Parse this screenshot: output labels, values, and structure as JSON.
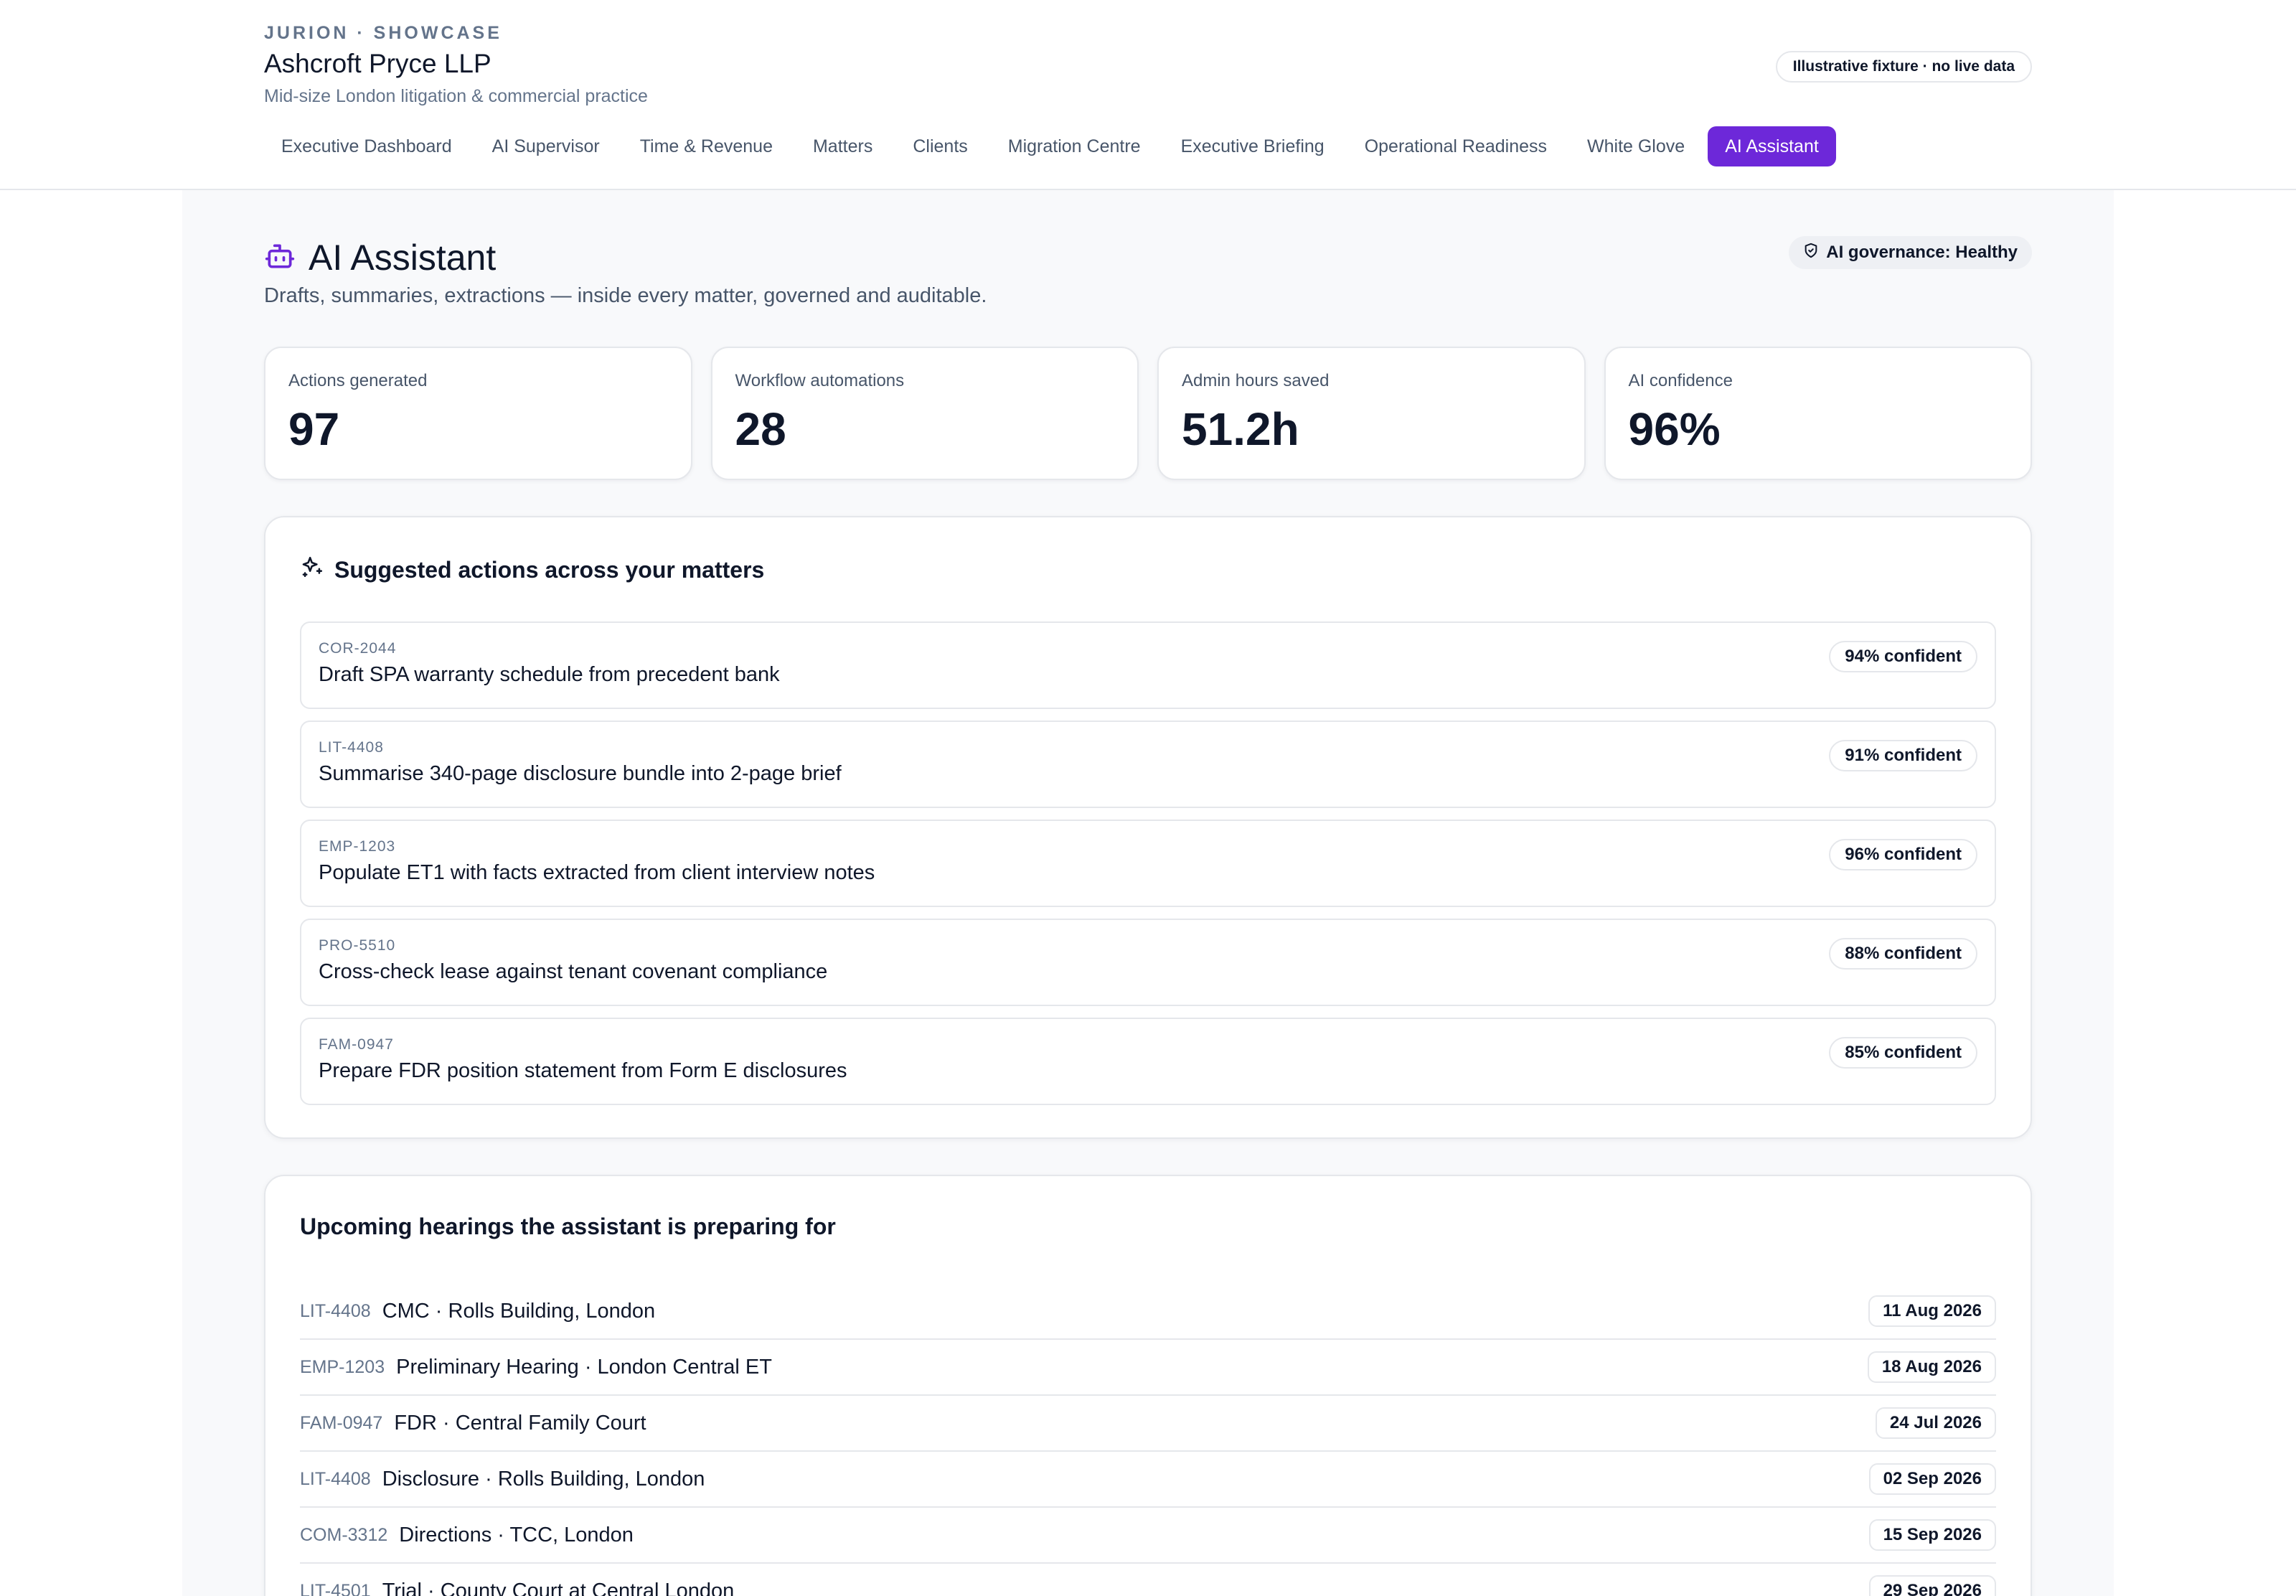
{
  "header": {
    "kicker": "JURION · SHOWCASE",
    "firm_name": "Ashcroft Pryce LLP",
    "firm_description": "Mid-size London litigation & commercial practice",
    "fixture_badge": "Illustrative fixture · no live data"
  },
  "nav": {
    "items": [
      {
        "label": "Executive Dashboard",
        "active": false
      },
      {
        "label": "AI Supervisor",
        "active": false
      },
      {
        "label": "Time & Revenue",
        "active": false
      },
      {
        "label": "Matters",
        "active": false
      },
      {
        "label": "Clients",
        "active": false
      },
      {
        "label": "Migration Centre",
        "active": false
      },
      {
        "label": "Executive Briefing",
        "active": false
      },
      {
        "label": "Operational Readiness",
        "active": false
      },
      {
        "label": "White Glove",
        "active": false
      },
      {
        "label": "AI Assistant",
        "active": true
      }
    ]
  },
  "page": {
    "title": "AI Assistant",
    "title_icon": "robot-icon",
    "subtitle": "Drafts, summaries, extractions — inside every matter, governed and auditable.",
    "governance_badge": "AI governance: Healthy",
    "governance_icon": "shield-check-icon"
  },
  "stats": [
    {
      "label": "Actions generated",
      "value": "97"
    },
    {
      "label": "Workflow automations",
      "value": "28"
    },
    {
      "label": "Admin hours saved",
      "value": "51.2h"
    },
    {
      "label": "AI confidence",
      "value": "96%"
    }
  ],
  "suggested_actions": {
    "title": "Suggested actions across your matters",
    "icon": "sparkles-icon",
    "items": [
      {
        "code": "COR-2044",
        "text": "Draft SPA warranty schedule from precedent bank",
        "confidence": "94% confident"
      },
      {
        "code": "LIT-4408",
        "text": "Summarise 340-page disclosure bundle into 2-page brief",
        "confidence": "91% confident"
      },
      {
        "code": "EMP-1203",
        "text": "Populate ET1 with facts extracted from client interview notes",
        "confidence": "96% confident"
      },
      {
        "code": "PRO-5510",
        "text": "Cross-check lease against tenant covenant compliance",
        "confidence": "88% confident"
      },
      {
        "code": "FAM-0947",
        "text": "Prepare FDR position statement from Form E disclosures",
        "confidence": "85% confident"
      }
    ]
  },
  "hearings": {
    "title": "Upcoming hearings the assistant is preparing for",
    "items": [
      {
        "code": "LIT-4408",
        "text": "CMC · Rolls Building, London",
        "date": "11 Aug 2026"
      },
      {
        "code": "EMP-1203",
        "text": "Preliminary Hearing · London Central ET",
        "date": "18 Aug 2026"
      },
      {
        "code": "FAM-0947",
        "text": "FDR · Central Family Court",
        "date": "24 Jul 2026"
      },
      {
        "code": "LIT-4408",
        "text": "Disclosure · Rolls Building, London",
        "date": "02 Sep 2026"
      },
      {
        "code": "COM-3312",
        "text": "Directions · TCC, London",
        "date": "15 Sep 2026"
      },
      {
        "code": "LIT-4501",
        "text": "Trial · County Court at Central London",
        "date": "29 Sep 2026"
      }
    ]
  },
  "colors": {
    "accent": "#6d28d9",
    "text": "#0f172a",
    "muted": "#64748b",
    "border": "#e5e7eb",
    "page_bg": "#f8f9fb"
  }
}
